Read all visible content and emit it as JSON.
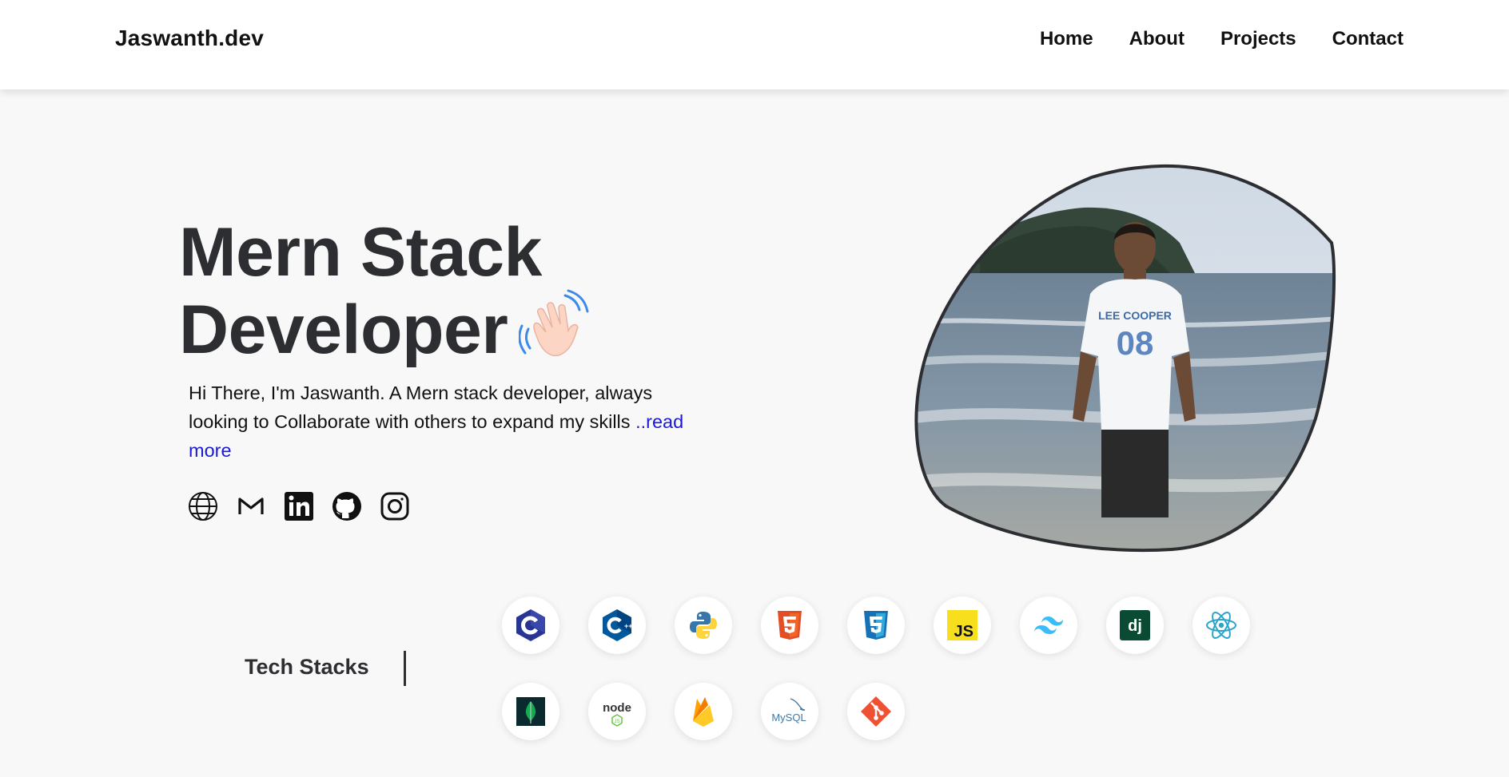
{
  "nav": {
    "brand": "Jaswanth.dev",
    "links": [
      "Home",
      "About",
      "Projects",
      "Contact"
    ]
  },
  "hero": {
    "title_line1": "Mern Stack",
    "title_line2": "Developer",
    "wave_icon": "waving-hand-emoji",
    "intro": "Hi There, I'm Jaswanth. A Mern stack developer, always looking to Collaborate with others to expand my skills",
    "read_more": "..read more"
  },
  "socials": [
    "globe-icon",
    "gmail-icon",
    "linkedin-icon",
    "github-icon",
    "instagram-icon"
  ],
  "tech": {
    "label": "Tech Stacks",
    "icons": [
      "c-icon",
      "cplusplus-icon",
      "python-icon",
      "html5-icon",
      "css3-icon",
      "javascript-icon",
      "tailwind-icon",
      "django-icon",
      "react-icon",
      "mongodb-icon",
      "nodejs-icon",
      "firebase-icon",
      "mysql-icon",
      "git-icon"
    ],
    "text_marks": {
      "js": "JS",
      "dj": "dj",
      "node": "node",
      "mysql": "MySQL"
    }
  },
  "colors": {
    "heading": "#2d2e32",
    "link": "#1919d6",
    "background": "#f8f8f8",
    "navbar": "#ffffff"
  }
}
